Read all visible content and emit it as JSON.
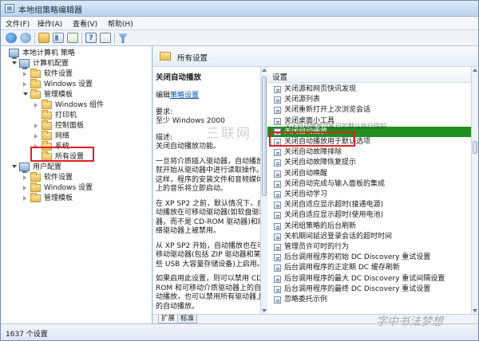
{
  "window": {
    "title": "本地组策略编辑器"
  },
  "menu": [
    "文件(F)",
    "操作(A)",
    "查看(V)",
    "帮助(H)"
  ],
  "tree": {
    "nodes": [
      {
        "label": "本地计算机 策略",
        "icon": "computer-icon",
        "level": 0,
        "toggle": ""
      },
      {
        "label": "计算机配置",
        "icon": "computer-icon",
        "level": 1,
        "toggle": "expanded"
      },
      {
        "label": "软件设置",
        "icon": "folder-icon",
        "level": 2,
        "toggle": "collapsed"
      },
      {
        "label": "Windows 设置",
        "icon": "folder-icon",
        "level": 2,
        "toggle": "collapsed"
      },
      {
        "label": "管理模板",
        "icon": "folder-icon",
        "level": 2,
        "toggle": "expanded"
      },
      {
        "label": "Windows 组件",
        "icon": "folder-icon",
        "level": 3,
        "toggle": "collapsed"
      },
      {
        "label": "打印机",
        "icon": "folder-icon",
        "level": 3,
        "toggle": ""
      },
      {
        "label": "控制面板",
        "icon": "folder-icon",
        "level": 3,
        "toggle": "collapsed"
      },
      {
        "label": "网络",
        "icon": "folder-icon",
        "level": 3,
        "toggle": "collapsed"
      },
      {
        "label": "系统",
        "icon": "folder-icon",
        "level": 3,
        "toggle": "collapsed"
      },
      {
        "label": "所有设置",
        "icon": "folder-icon",
        "level": 3,
        "toggle": "",
        "selected": true
      },
      {
        "label": "用户配置",
        "icon": "computer-icon",
        "level": 1,
        "toggle": "expanded"
      },
      {
        "label": "软件设置",
        "icon": "folder-icon",
        "level": 2,
        "toggle": "collapsed"
      },
      {
        "label": "Windows 设置",
        "icon": "folder-icon",
        "level": 2,
        "toggle": "collapsed"
      },
      {
        "label": "管理模板",
        "icon": "folder-icon",
        "level": 2,
        "toggle": "collapsed"
      }
    ]
  },
  "right_header": {
    "title": "所有设置"
  },
  "description": {
    "heading": "关闭自动播放",
    "edit_prefix": "编辑",
    "edit_link": "策略设置",
    "req_label": "要求:",
    "req_value": "至少 Windows 2000",
    "desc_label": "描述:",
    "desc_first": "关闭自动播放功能。",
    "p1": "一旦将介质插入驱动器，自动播放就开始从驱动器中进行读取操作。这样，程序的安装文件和音频媒体上的音乐将立即启动。",
    "p2": "在 XP SP2 之前，默认情况下，自动播放在可移动驱动器(如软盘驱动器，而不是 CD-ROM 驱动器)和网络驱动器上被禁用。",
    "p3": "从 XP SP2 开始，自动播放也在可移动驱动器(包括 ZIP 驱动器和某些 USB 大容量存储设备)上启用。",
    "p4": "如果启用此设置，则可以禁用 CD-ROM 和可移动介质驱动器上的自动播放，也可以禁用所有驱动器上的自动播放。"
  },
  "settings": {
    "column_header": "设置",
    "items": [
      "关闭源和网页快讯发现",
      "关闭源列表",
      "关闭重新打开上次浏览会话",
      "关闭桌面小工具",
      "关闭自动播放",
      "关闭自动播放用于默认选项",
      "关闭自动故障排除",
      "关闭自动故障恢复提示",
      "关闭自动唤醒",
      "关闭自动完成与输入面板的集成",
      "关闭自动学习",
      "关闭自适应显示超时(接通电源)",
      "关闭自适应显示超时(使用电池)",
      "关闭组策略的后台刷新",
      "关机期间延迟登录会话的超时时间",
      "管理员许可时的行为",
      "后台调用程序的初始 DC Discovery 重试设置",
      "后台调用程序的正定期 DC 缓存刷新",
      "后台调用程序的最大 DC Discovery 重试间隔设置",
      "后台调用程序的最终 DC Discovery 重试设置",
      "忽略委托示例"
    ],
    "overlay_row_text": "关闭自动播放可能已的默认执行保护",
    "selected_index": 4,
    "selected_color": "#1f8f1f"
  },
  "tabs": [
    "扩展",
    "标准"
  ],
  "status": {
    "count": "1637 个设置"
  },
  "watermarks": {
    "center": "三联网",
    "corner": "字中书法梦想"
  }
}
